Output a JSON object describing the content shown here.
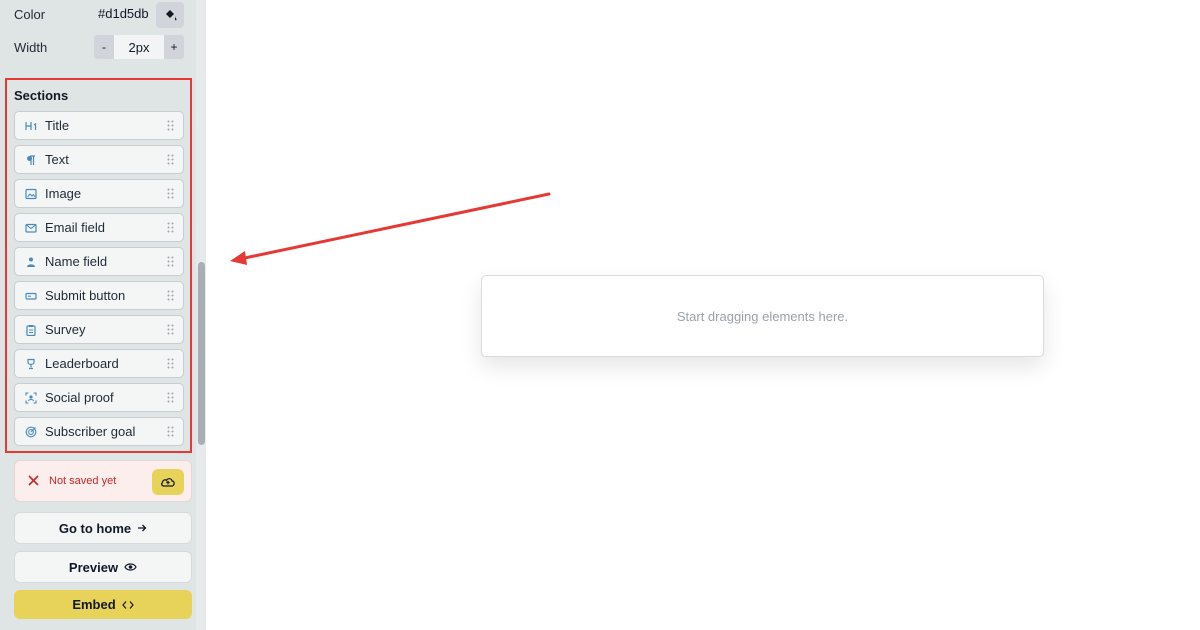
{
  "sidebar": {
    "color": {
      "label": "Color",
      "value": "#d1d5db",
      "icon": "paint-bucket-icon"
    },
    "width": {
      "label": "Width",
      "minus": "-",
      "value": "2px",
      "plus": "+"
    },
    "sections_title": "Sections",
    "sections": [
      {
        "label": "Title",
        "icon": "heading-icon"
      },
      {
        "label": "Text",
        "icon": "paragraph-icon"
      },
      {
        "label": "Image",
        "icon": "image-icon"
      },
      {
        "label": "Email field",
        "icon": "mail-icon"
      },
      {
        "label": "Name field",
        "icon": "person-icon"
      },
      {
        "label": "Submit button",
        "icon": "button-icon"
      },
      {
        "label": "Survey",
        "icon": "clipboard-icon"
      },
      {
        "label": "Leaderboard",
        "icon": "trophy-icon"
      },
      {
        "label": "Social proof",
        "icon": "face-scan-icon"
      },
      {
        "label": "Subscriber goal",
        "icon": "target-icon"
      }
    ],
    "status": {
      "text": "Not saved yet",
      "icon": "close-icon",
      "action_icon": "cloud-upload-icon"
    },
    "go_home": {
      "label": "Go to home",
      "icon": "arrow-right-icon"
    },
    "preview": {
      "label": "Preview",
      "icon": "eye-icon"
    },
    "embed": {
      "label": "Embed",
      "icon": "code-icon"
    }
  },
  "canvas": {
    "placeholder": "Start dragging elements here."
  },
  "colors": {
    "sidebar_bg": "#dfe5e4",
    "accent_yellow": "#e8d35a",
    "annotation_red": "#e53935",
    "error_red": "#c62828"
  }
}
